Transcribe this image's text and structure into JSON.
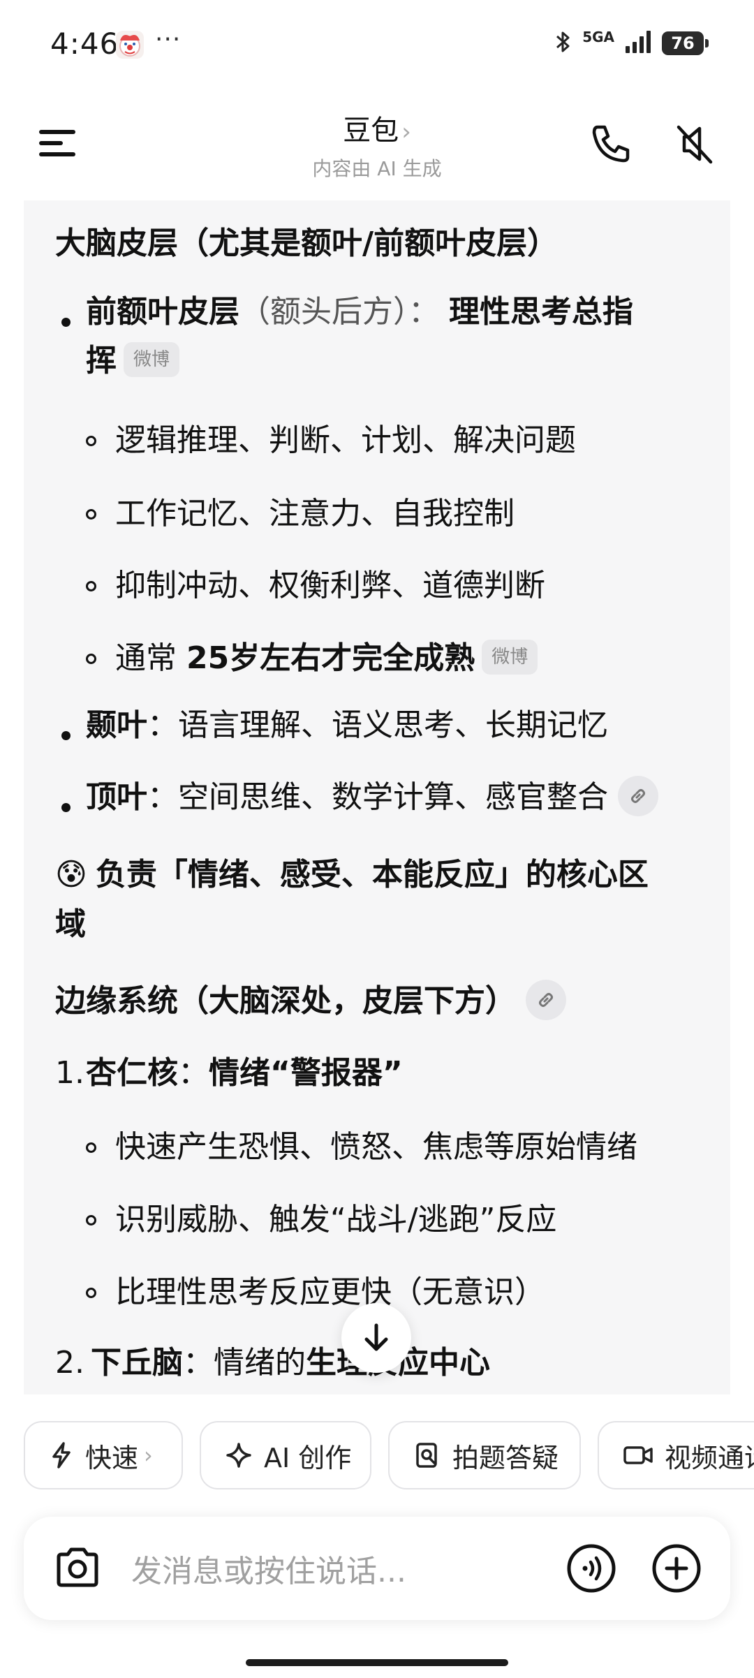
{
  "status_bar": {
    "time": "4:46",
    "app_icon": "clown-face-app-icon",
    "more_indicator": "···",
    "network": "5GA",
    "battery": "76"
  },
  "header": {
    "title": "豆包",
    "title_chevron": "›",
    "subtitle": "内容由 AI 生成",
    "icons": [
      "menu-icon",
      "phone-icon",
      "speaker-muted-icon"
    ]
  },
  "chat": {
    "heading1": "大脑皮层（尤其是额叶/前额叶皮层）",
    "pfc": {
      "label": "前额叶皮层",
      "location": "（额头后方）：",
      "role_line1": "理性思考总指",
      "role_line2": "挥",
      "source": "微博",
      "items": [
        "逻辑推理、判断、计划、解决问题",
        "工作记忆、注意力、自我控制",
        "抑制冲动、权衡利弊、道德判断"
      ],
      "item4_prefix": "通常 ",
      "item4_bold": "25岁左右才完全成熟",
      "item4_source": "微博"
    },
    "temporal": {
      "label": "颞叶",
      "text": "：语言理解、语义思考、长期记忆"
    },
    "parietal": {
      "label": "顶叶",
      "text": "：空间思维、数学计算、感官整合"
    },
    "emoji_heading": {
      "emoji": "😰",
      "line1": "负责「情绪、感受、本能反应」的核心区",
      "line2": "域"
    },
    "limbic_heading": "边缘系统（大脑深处，皮层下方）",
    "amygdala": {
      "num": "1.",
      "label": "杏仁核",
      "colon": "：",
      "role": "情绪“警报器”",
      "items": [
        "快速产生恐惧、愤怒、焦虑等原始情绪",
        "识别威胁、触发“战斗/逃跑”反应",
        "比理性思考反应更快（无意识）"
      ]
    },
    "hypothalamus": {
      "num": "2.",
      "label": "下丘脑",
      "colon": "：",
      "text": "情绪的",
      "bold": "生理反应中心"
    }
  },
  "quick_actions": [
    {
      "label": "快速",
      "icon": "lightning-icon",
      "chevron": "›"
    },
    {
      "label": "AI 创作",
      "icon": "sparkle-icon"
    },
    {
      "label": "拍题答疑",
      "icon": "search-doc-icon"
    },
    {
      "label": "视频通话",
      "icon": "video-icon"
    }
  ],
  "input": {
    "placeholder": "发消息或按住说话...",
    "icons": [
      "camera-icon",
      "voice-wave-icon",
      "plus-icon"
    ]
  }
}
